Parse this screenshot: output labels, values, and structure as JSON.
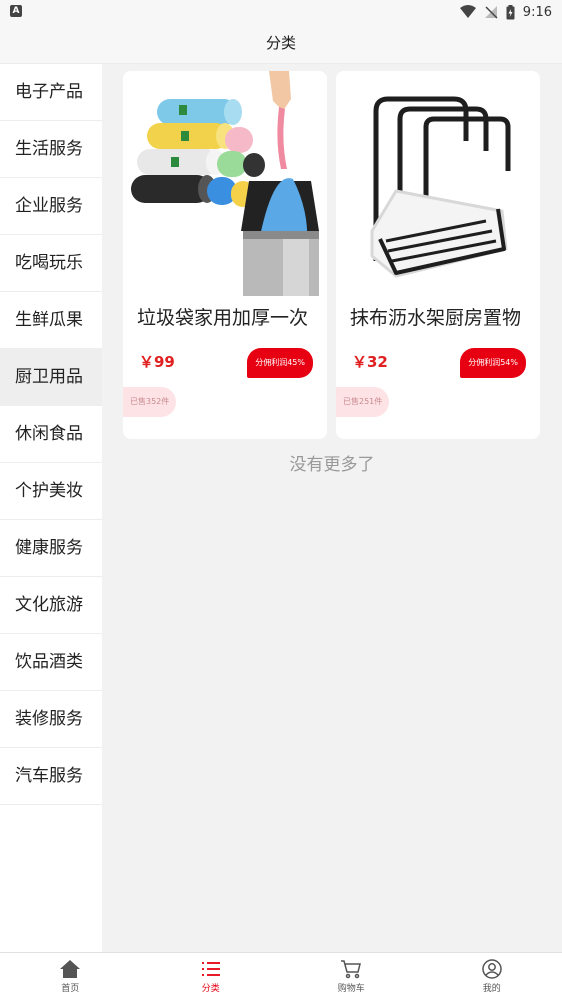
{
  "status_bar": {
    "app_badge": "A",
    "time": "9:16"
  },
  "header": {
    "title": "分类"
  },
  "sidebar": {
    "items": [
      {
        "label": "电子产品"
      },
      {
        "label": "生活服务"
      },
      {
        "label": "企业服务"
      },
      {
        "label": "吃喝玩乐"
      },
      {
        "label": "生鲜瓜果"
      },
      {
        "label": "厨卫用品",
        "active": true
      },
      {
        "label": "休闲食品"
      },
      {
        "label": "个护美妆"
      },
      {
        "label": "健康服务"
      },
      {
        "label": "文化旅游"
      },
      {
        "label": "饮品酒类"
      },
      {
        "label": "装修服务"
      },
      {
        "label": "汽车服务"
      }
    ]
  },
  "products": [
    {
      "title": "垃圾袋家用加厚一次",
      "price": "￥99",
      "commission": "分佣利润45%",
      "sold": "已售352件",
      "image_icon": "trash-bag-image"
    },
    {
      "title": "抹布沥水架厨房置物",
      "price": "￥32",
      "commission": "分佣利润54%",
      "sold": "已售251件",
      "image_icon": "drain-rack-image"
    }
  ],
  "list_end_text": "没有更多了",
  "bottom_nav": {
    "items": [
      {
        "label": "首页",
        "icon": "home-icon"
      },
      {
        "label": "分类",
        "icon": "category-list-icon",
        "active": true
      },
      {
        "label": "购物车",
        "icon": "cart-icon"
      },
      {
        "label": "我的",
        "icon": "profile-icon"
      }
    ]
  },
  "colors": {
    "accent": "#e60012",
    "price": "#e02020",
    "sold_bg": "#fde3e6"
  }
}
